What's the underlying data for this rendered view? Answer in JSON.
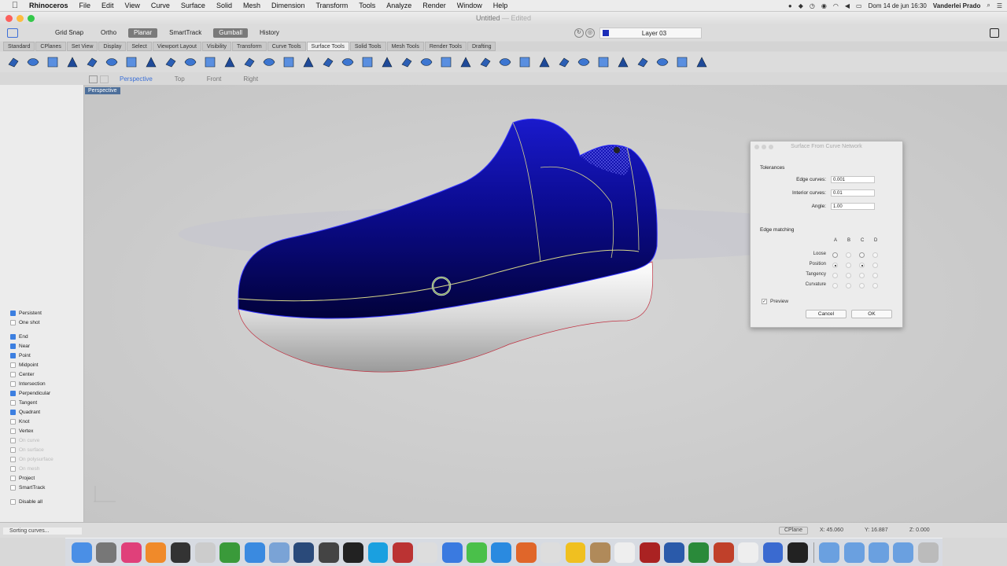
{
  "menubar": {
    "app": "Rhinoceros",
    "items": [
      "File",
      "Edit",
      "View",
      "Curve",
      "Surface",
      "Solid",
      "Mesh",
      "Dimension",
      "Transform",
      "Tools",
      "Analyze",
      "Render",
      "Window",
      "Help"
    ],
    "clock": "Dom 14 de jun  16:30",
    "user": "Vanderlei Prado"
  },
  "window": {
    "title": "Untitled",
    "edited": "— Edited"
  },
  "toolbar": {
    "grid_snap": "Grid Snap",
    "ortho": "Ortho",
    "planar": "Planar",
    "smarttrack": "SmartTrack",
    "gumball": "Gumball",
    "history": "History",
    "circle1": "↻",
    "circle2": "◎",
    "layer": "Layer 03"
  },
  "tabs": [
    "Standard",
    "CPlanes",
    "Set View",
    "Display",
    "Select",
    "Viewport Layout",
    "Visibility",
    "Transform",
    "Curve Tools",
    "Surface Tools",
    "Solid Tools",
    "Mesh Tools",
    "Render Tools",
    "Drafting"
  ],
  "icon_tools": [
    "loft-icon",
    "rail-revolve-icon",
    "sweep1-icon",
    "sweep2-icon",
    "extrude-icon",
    "network-srf-icon",
    "patch-icon",
    "blend-srf-icon",
    "offset-srf-icon",
    "fillet-srf-icon",
    "chamfer-srf-icon",
    "split-icon",
    "trim-icon",
    "untrim-icon",
    "join-icon",
    "explode-icon",
    "rebuild-icon",
    "unroll-icon",
    "match-srf-icon",
    "merge-srf-icon",
    "extend-srf-icon",
    "flow-icon",
    "cage-icon",
    "points-on-icon",
    "points-off-icon",
    "edit-pt-icon",
    "control-pts-icon",
    "bend-icon",
    "twist-icon",
    "taper-icon",
    "shear-icon",
    "smash-icon",
    "analysis-icon",
    "zebra-icon",
    "curvature-icon",
    "emap-icon"
  ],
  "viewport_tabs": [
    "Perspective",
    "Top",
    "Front",
    "Right"
  ],
  "viewport": {
    "label": "Perspective"
  },
  "osnap": [
    {
      "label": "Persistent",
      "on": true,
      "dim": false
    },
    {
      "label": "One shot",
      "on": false,
      "dim": false
    },
    {
      "label": "End",
      "on": true,
      "dim": false,
      "gap": true
    },
    {
      "label": "Near",
      "on": true,
      "dim": false
    },
    {
      "label": "Point",
      "on": true,
      "dim": false
    },
    {
      "label": "Midpoint",
      "on": false,
      "dim": false
    },
    {
      "label": "Center",
      "on": false,
      "dim": false
    },
    {
      "label": "Intersection",
      "on": false,
      "dim": false
    },
    {
      "label": "Perpendicular",
      "on": true,
      "dim": false
    },
    {
      "label": "Tangent",
      "on": false,
      "dim": false
    },
    {
      "label": "Quadrant",
      "on": true,
      "dim": false
    },
    {
      "label": "Knot",
      "on": false,
      "dim": false
    },
    {
      "label": "Vertex",
      "on": false,
      "dim": false
    },
    {
      "label": "On curve",
      "on": false,
      "dim": true
    },
    {
      "label": "On surface",
      "on": false,
      "dim": true
    },
    {
      "label": "On polysurface",
      "on": false,
      "dim": true
    },
    {
      "label": "On mesh",
      "on": false,
      "dim": true
    },
    {
      "label": "Project",
      "on": false,
      "dim": false
    },
    {
      "label": "SmartTrack",
      "on": false,
      "dim": false
    },
    {
      "label": "Disable all",
      "on": false,
      "dim": false,
      "gap": true
    }
  ],
  "dialog": {
    "title": "Surface From Curve Network",
    "tolerances_label": "Tolerances",
    "edge_curves_label": "Edge curves:",
    "edge_curves_value": "0.001",
    "interior_curves_label": "Interior curves:",
    "interior_curves_value": "0.01",
    "angle_label": "Angle:",
    "angle_value": "1.00",
    "edge_matching_label": "Edge matching",
    "columns": [
      "A",
      "B",
      "C",
      "D"
    ],
    "match_rows": [
      "Loose",
      "Position",
      "Tangency",
      "Curvature"
    ],
    "preview_label": "Preview",
    "cancel": "Cancel",
    "ok": "OK"
  },
  "status": {
    "command": "Sorting curves...",
    "cplane": "CPlane",
    "x": "X: 45.060",
    "y": "Y: 16.887",
    "z": "Z: 0.000"
  },
  "colors": {
    "shoe_upper": "#0a0a8a",
    "shoe_sole": "#e6e6e6",
    "accent": "#3c7fe0"
  }
}
